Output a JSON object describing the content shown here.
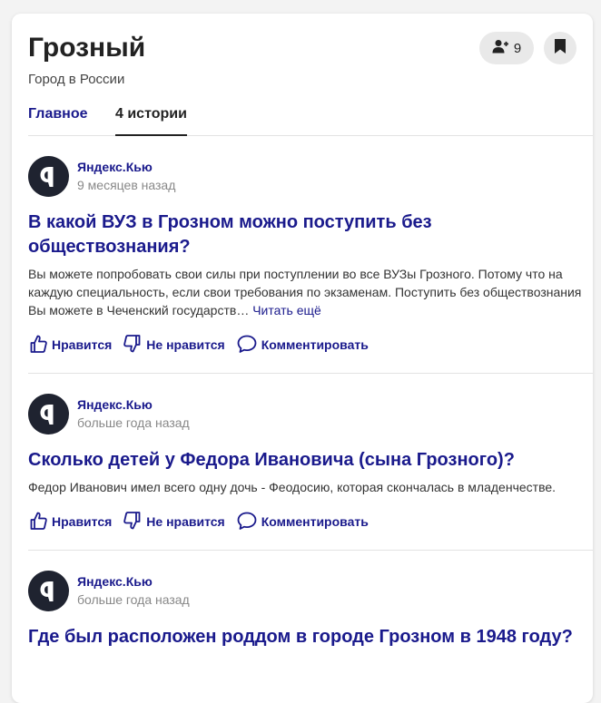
{
  "header": {
    "title": "Грозный",
    "subtitle": "Город в России",
    "followers_count": "9"
  },
  "tabs": [
    {
      "label": "Главное",
      "active": false
    },
    {
      "label": "4 истории",
      "active": true
    }
  ],
  "posts": [
    {
      "source": "Яндекс.Кью",
      "time": "9 месяцев назад",
      "title": "В какой ВУЗ в Грозном можно поступить без обществознания?",
      "excerpt": "Вы можете попробовать свои силы при поступлении во все ВУЗы Грозного. Потому что на каждую специальность, если свои требования по экзаменам. Поступить без обществознания Вы можете в Чеченский государств…",
      "read_more": "Читать ещё",
      "like_label": "Нравится",
      "dislike_label": "Не нравится",
      "comment_label": "Комментировать"
    },
    {
      "source": "Яндекс.Кью",
      "time": "больше года назад",
      "title": "Сколько детей у Федора Ивановича (сына Грозного)?",
      "excerpt": "Федор Иванович имел всего одну дочь - Феодосию, которая скончалась в младенчестве.",
      "like_label": "Нравится",
      "dislike_label": "Не нравится",
      "comment_label": "Комментировать"
    },
    {
      "source": "Яндекс.Кью",
      "time": "больше года назад",
      "title": "Где был расположен роддом в городе Грозном в 1948 году?"
    }
  ],
  "icons": {
    "follow": "person-add-icon",
    "bookmark": "bookmark-icon",
    "avatar": "yandex-q-logo-icon",
    "like": "thumbs-up-icon",
    "dislike": "thumbs-down-icon",
    "comment": "comment-bubble-icon"
  },
  "colors": {
    "link": "#1a1a8c",
    "avatar_bg": "#1f2330",
    "button_bg": "#e9e9e9"
  }
}
